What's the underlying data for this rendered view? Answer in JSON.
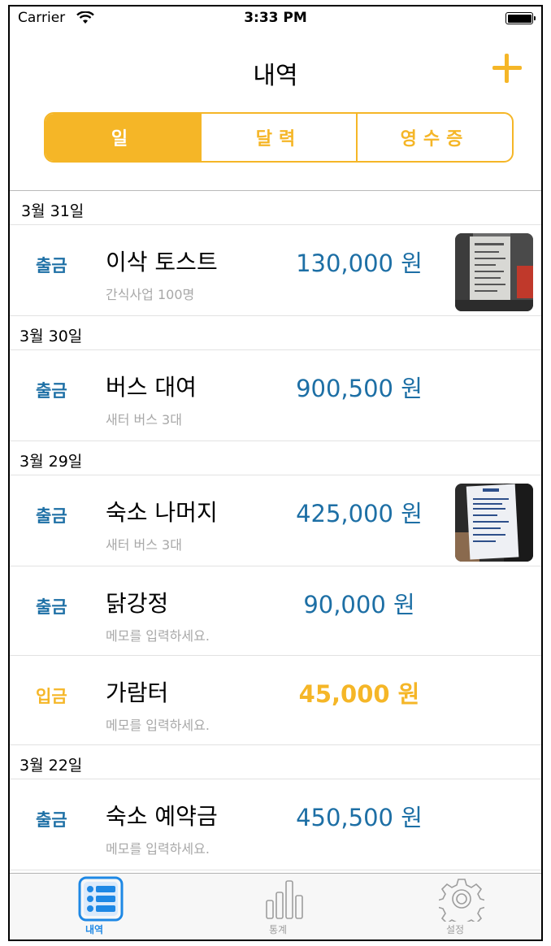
{
  "status_bar": {
    "carrier": "Carrier",
    "time": "3:33 PM",
    "battery_level": 1.0
  },
  "nav": {
    "title": "내역",
    "add_icon": "plus-icon"
  },
  "segments": [
    {
      "label": "일",
      "active": true
    },
    {
      "label": "달력",
      "active": false
    },
    {
      "label": "영수증",
      "active": false
    }
  ],
  "sections": [
    {
      "date": "3월 31일",
      "entries": [
        {
          "type": "출금",
          "kind": "expense",
          "title": "이삭 토스트",
          "memo": "간식사업 100명",
          "amount": "130,000 원",
          "has_receipt": true
        }
      ]
    },
    {
      "date": "3월 30일",
      "entries": [
        {
          "type": "출금",
          "kind": "expense",
          "title": "버스 대여",
          "memo": "새터 버스 3대",
          "amount": "900,500 원",
          "has_receipt": false
        }
      ]
    },
    {
      "date": "3월 29일",
      "entries": [
        {
          "type": "출금",
          "kind": "expense",
          "title": "숙소 나머지",
          "memo": "새터 버스 3대",
          "amount": "425,000 원",
          "has_receipt": true
        },
        {
          "type": "출금",
          "kind": "expense",
          "title": "닭강정",
          "memo": "메모를 입력하세요.",
          "amount": "90,000 원",
          "has_receipt": false
        },
        {
          "type": "입금",
          "kind": "income",
          "title": "가람터",
          "memo": "메모를 입력하세요.",
          "amount": "45,000 원",
          "has_receipt": false
        }
      ]
    },
    {
      "date": "3월 22일",
      "entries": [
        {
          "type": "출금",
          "kind": "expense",
          "title": "숙소 예약금",
          "memo": "메모를 입력하세요.",
          "amount": "450,500 원",
          "has_receipt": false
        }
      ]
    }
  ],
  "tabbar": {
    "tabs": [
      {
        "label": "내역",
        "icon": "list-icon",
        "active": true
      },
      {
        "label": "통계",
        "icon": "bar-chart-icon",
        "active": false
      },
      {
        "label": "설정",
        "icon": "gear-icon",
        "active": false
      }
    ]
  },
  "colors": {
    "accent": "#f5b627",
    "expense": "#1d6fa5",
    "tab_active": "#1e88e5"
  }
}
